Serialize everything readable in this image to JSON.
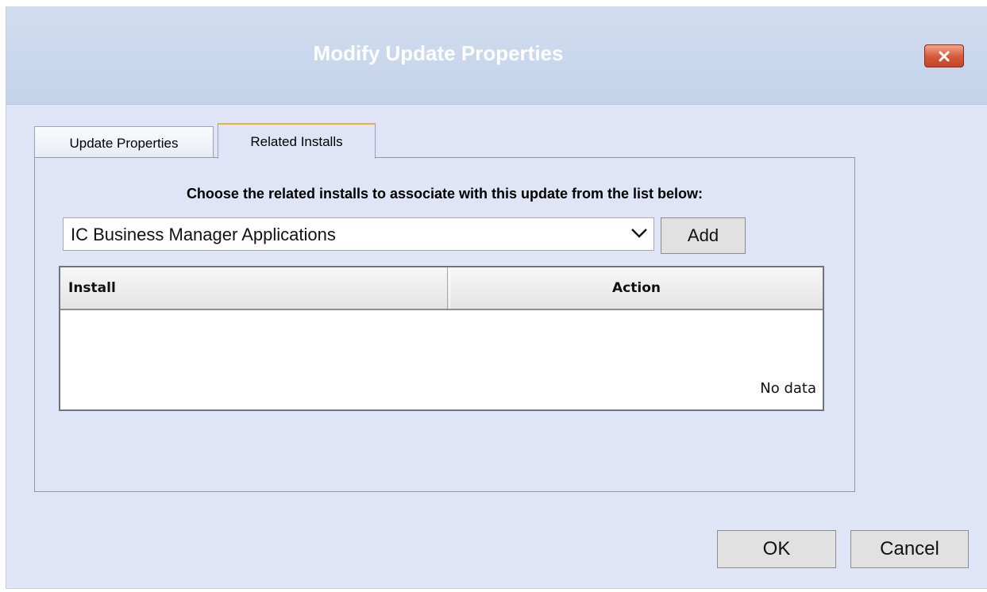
{
  "dialog": {
    "title": "Modify Update Properties",
    "close_icon": "close-icon"
  },
  "tabs": [
    {
      "label": "Update Properties",
      "active": false
    },
    {
      "label": "Related Installs",
      "active": true
    }
  ],
  "related_installs": {
    "instructions": "Choose the related installs to associate with this update from the list below:",
    "install_select": {
      "value": "IC Business Manager Applications",
      "icon": "chevron-down-icon"
    },
    "add_label": "Add",
    "table": {
      "columns": [
        "Install",
        "Action"
      ],
      "rows": [],
      "empty_text": "No data"
    }
  },
  "footer": {
    "ok_label": "OK",
    "cancel_label": "Cancel"
  }
}
